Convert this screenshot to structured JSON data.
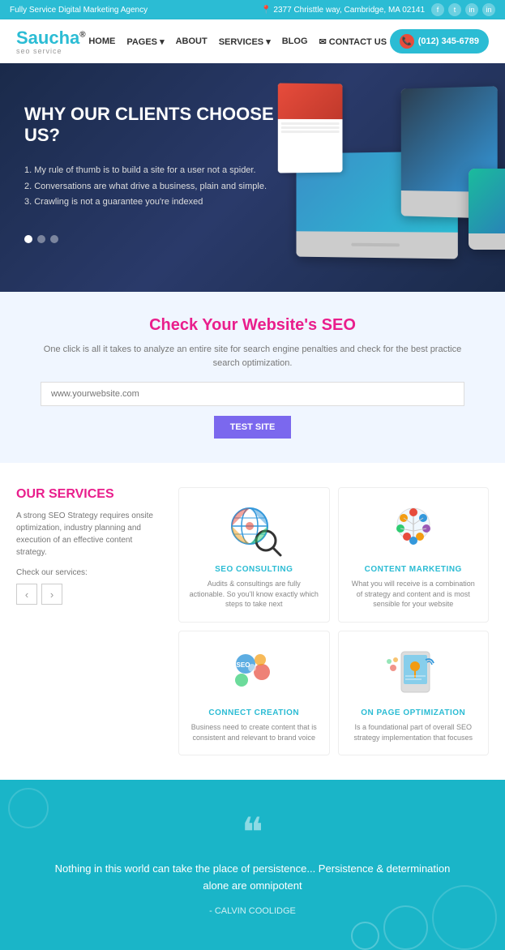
{
  "topbar": {
    "agency_label": "Fully Service Digital Marketing Agency",
    "address": "2377 Christtle way, Cambridge, MA 02141",
    "socials": [
      "f",
      "t",
      "in",
      "in"
    ]
  },
  "nav": {
    "logo_name": "Saucha",
    "logo_super": "®",
    "logo_sub": "seo service",
    "links": [
      "HOME",
      "PAGES ▾",
      "ABOUT",
      "SERVICES ▾",
      "BLOG",
      "✉ CONTACT US"
    ],
    "phone": "(012) 345-6789"
  },
  "hero": {
    "title": "WHY OUR CLIENTS CHOOSE US?",
    "list": [
      "My rule of thumb is to build a site for a user not a spider.",
      "Conversations are what drive a business, plain and simple.",
      "Crawling is not a guarantee you're indexed"
    ]
  },
  "seo_check": {
    "title": "Check Your Website's SEO",
    "description": "One click is all it takes to analyze an entire site for search engine penalties and check for the best practice search optimization.",
    "placeholder": "www.yourwebsite.com",
    "button_label": "TEST SITE"
  },
  "services": {
    "heading": "OUR SERVICES",
    "description": "A strong SEO Strategy requires onsite optimization, industry planning and execution of an effective content strategy.",
    "check_label": "Check our services:",
    "cards": [
      {
        "id": "seo-consulting",
        "title": "SEO CONSULTING",
        "description": "Audits & consultings are fully actionable. So you'll know exactly which steps to take next",
        "icon_type": "globe"
      },
      {
        "id": "content-marketing",
        "title": "CONTENT MARKETING",
        "description": "What you will receive is a combination of strategy and content and is most sensible for your website",
        "icon_type": "content"
      },
      {
        "id": "connect-creation",
        "title": "CONNECT CREATION",
        "description": "Business need to create content that is consistent and relevant to brand voice",
        "icon_type": "connect"
      },
      {
        "id": "on-page-optimization",
        "title": "ON PAGE OPTIMIZATION",
        "description": "Is a foundational part of overall SEO strategy implementation that focuses",
        "icon_type": "onpage"
      }
    ]
  },
  "testimonial": {
    "quote": "Nothing in this world can take the place of persistence... Persistence & determination alone are omnipotent",
    "author": "- CALVIN COOLIDGE"
  }
}
